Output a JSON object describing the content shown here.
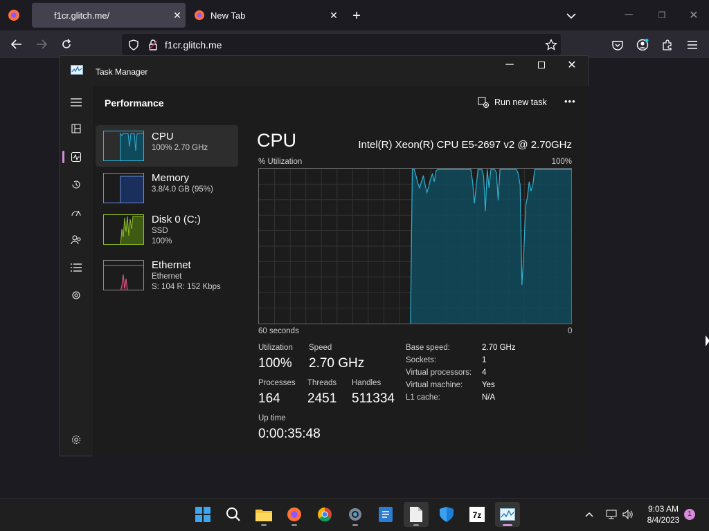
{
  "browser": {
    "tabs": [
      {
        "title": "f1cr.glitch.me/",
        "active": true
      },
      {
        "title": "New Tab",
        "active": false
      }
    ],
    "url": "f1cr.glitch.me",
    "icons": [
      "back-icon",
      "forward-icon",
      "reload-icon",
      "shield-icon",
      "lock-icon",
      "bookmark-star-icon",
      "pocket-icon",
      "account-icon",
      "extensions-icon",
      "menu-icon"
    ]
  },
  "task_manager": {
    "window_title": "Task Manager",
    "section_title": "Performance",
    "run_new_task": "Run new task",
    "more": "•••",
    "resources": [
      {
        "name": "CPU",
        "detail1": "100%  2.70 GHz",
        "detail2": "",
        "color": "#2fb2d4"
      },
      {
        "name": "Memory",
        "detail1": "3.8/4.0 GB (95%)",
        "detail2": "",
        "color": "#6b8cdb"
      },
      {
        "name": "Disk 0 (C:)",
        "detail1": "SSD",
        "detail2": "100%",
        "color": "#8fbf2a"
      },
      {
        "name": "Ethernet",
        "detail1": "Ethernet",
        "detail2": "S: 104  R: 152 Kbps",
        "color": "#e05c8a"
      }
    ],
    "cpu": {
      "heading": "CPU",
      "model": "Intel(R) Xeon(R) CPU E5-2697 v2 @ 2.70GHz",
      "graph_label_left": "% Utilization",
      "graph_label_right": "100%",
      "axis_left": "60 seconds",
      "axis_right": "0",
      "utilization_label": "Utilization",
      "utilization": "100%",
      "speed_label": "Speed",
      "speed": "2.70 GHz",
      "processes_label": "Processes",
      "processes": "164",
      "threads_label": "Threads",
      "threads": "2451",
      "handles_label": "Handles",
      "handles": "511334",
      "uptime_label": "Up time",
      "uptime": "0:00:35:48",
      "details": [
        {
          "label": "Base speed:",
          "value": "2.70 GHz"
        },
        {
          "label": "Sockets:",
          "value": "1"
        },
        {
          "label": "Virtual processors:",
          "value": "4"
        },
        {
          "label": "Virtual machine:",
          "value": "Yes"
        },
        {
          "label": "L1 cache:",
          "value": "N/A"
        }
      ],
      "history_percent": [
        0,
        0,
        0,
        0,
        0,
        0,
        0,
        0,
        0,
        0,
        0,
        0,
        0,
        0,
        0,
        0,
        0,
        0,
        0,
        0,
        0,
        0,
        0,
        0,
        0,
        0,
        0,
        0,
        0,
        0,
        0,
        0,
        0,
        0,
        0,
        0,
        0,
        0,
        0,
        0,
        0,
        0,
        0,
        0,
        0,
        0,
        0,
        0,
        0,
        0,
        0,
        0,
        0,
        0,
        0,
        0,
        0,
        0,
        0,
        0,
        0,
        0,
        0,
        0,
        0,
        0,
        0,
        0,
        0,
        0,
        0,
        0,
        0,
        0,
        0,
        0,
        0,
        0,
        0,
        0,
        0,
        0,
        0,
        0,
        100,
        100,
        96,
        91,
        88,
        92,
        96,
        90,
        85,
        89,
        94,
        97,
        92,
        99,
        100,
        100,
        100,
        100,
        100,
        100,
        100,
        100,
        100,
        100,
        100,
        100,
        100,
        100,
        100,
        100,
        100,
        100,
        100,
        92,
        78,
        90,
        100,
        100,
        100,
        96,
        73,
        100,
        88,
        100,
        100,
        100,
        98,
        80,
        100,
        100,
        100,
        100,
        100,
        100,
        100,
        100,
        100,
        100,
        97,
        90,
        25,
        45,
        76,
        82,
        92,
        86,
        90,
        100,
        100,
        100,
        100,
        100,
        100,
        100,
        100,
        100,
        100,
        100,
        100,
        100,
        100,
        100,
        100,
        100,
        100,
        100,
        100,
        100
      ]
    }
  },
  "taskbar": {
    "apps": [
      "start",
      "search",
      "file-explorer",
      "firefox",
      "chrome",
      "settings",
      "notepad-like",
      "files",
      "defender",
      "7zip",
      "task-manager"
    ],
    "time": "9:03 AM",
    "date": "8/4/2023",
    "notification_count": "1"
  },
  "colors": {
    "accent": "#d88bd8",
    "cpu_line": "#2fb2d4",
    "cpu_fill": "#0f4a5c"
  }
}
